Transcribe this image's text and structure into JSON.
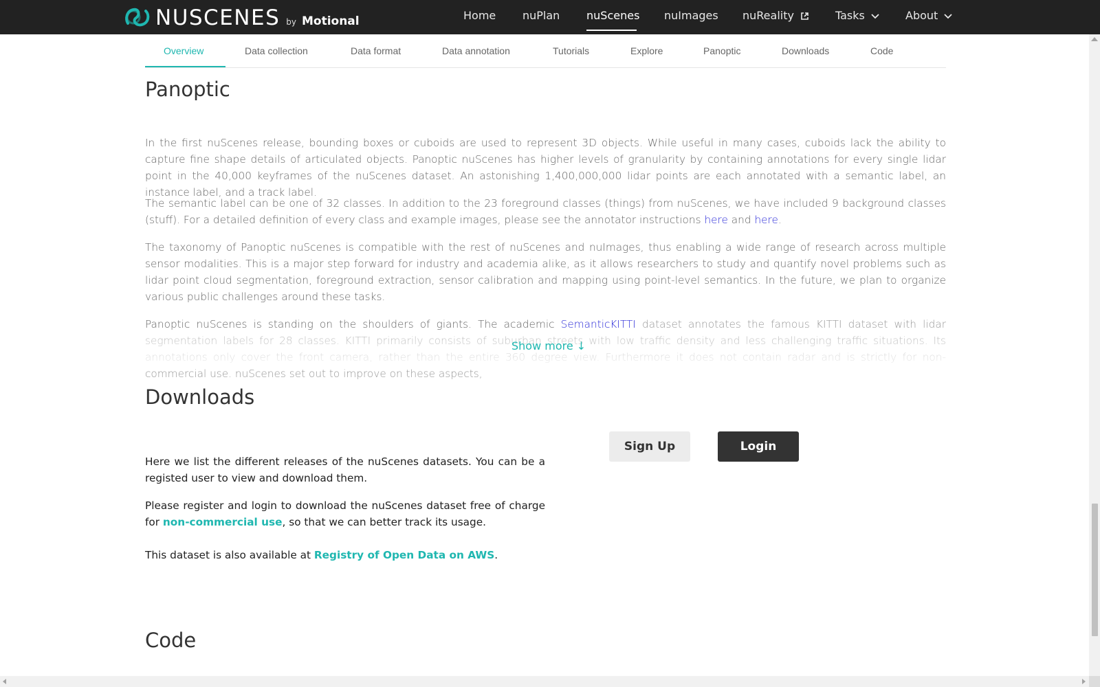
{
  "brand": {
    "name": "NUSCENES",
    "by": "by",
    "company": "Motional"
  },
  "nav": {
    "items": [
      {
        "label": "Home"
      },
      {
        "label": "nuPlan"
      },
      {
        "label": "nuScenes"
      },
      {
        "label": "nuImages"
      },
      {
        "label": "nuReality"
      },
      {
        "label": "Tasks"
      },
      {
        "label": "About"
      }
    ],
    "active": "nuScenes"
  },
  "subtabs": {
    "items": [
      "Overview",
      "Data collection",
      "Data format",
      "Data annotation",
      "Tutorials",
      "Explore",
      "Panoptic",
      "Downloads",
      "Code"
    ],
    "active": "Overview"
  },
  "panoptic": {
    "title": "Panoptic",
    "p1": "In the first nuScenes release, bounding boxes or cuboids are used to represent 3D objects. While useful in many cases, cuboids lack the ability to capture fine shape details of articulated objects. Panoptic nuScenes has higher levels of granularity by containing annotations for every single lidar point in the 40,000 keyframes of the nuScenes dataset. An astonishing 1,400,000,000 lidar points are each annotated with a semantic label, an instance label, and a track label.",
    "p2_before": "The semantic label can be one of 32 classes. In addition to the 23 foreground classes (things) from nuScenes, we have included 9 background classes (stuff). For a detailed definition of every class and example images, please see the annotator instructions ",
    "p2_link1": "here",
    "p2_mid": " and ",
    "p2_link2": "here",
    "p2_after": ".",
    "p3": "The taxonomy of Panoptic nuScenes is compatible with the rest of nuScenes and nuImages, thus enabling a wide range of research across multiple sensor modalities. This is a major step forward for industry and academia alike, as it allows researchers to study and quantify novel problems such as lidar point cloud segmentation, foreground extraction, sensor calibration and mapping using point-level semantics. In the future, we plan to organize various public challenges around these tasks.",
    "p4_before": "Panoptic nuScenes is standing on the shoulders of giants. The academic ",
    "p4_link": "SemanticKITTI",
    "p4_after": " dataset annotates the famous KITTI dataset with lidar segmentation labels for 28 classes. KITTI primarily consists of suburban streets with low traffic density and less challenging traffic situations. Its annotations only cover the front camera, rather than the entire 360 degree view. Furthermore it does not contain radar and is strictly for non-commercial use. nuScenes set out to improve on these aspects,",
    "show_more": "Show more ↓"
  },
  "downloads": {
    "title": "Downloads",
    "p1": "Here we list the different releases of the nuScenes datasets. You can be a registed user to view and download them.",
    "p2_before": "Please register and login to download the nuScenes dataset free of charge for ",
    "p2_link": "non-commercial use",
    "p2_after": ", so that we can better track its usage.",
    "p3_before": "This dataset is also available at ",
    "p3_link": "Registry of Open Data on AWS",
    "p3_after": ".",
    "signup": "Sign Up",
    "login": "Login"
  },
  "code": {
    "title": "Code"
  },
  "colors": {
    "accent": "#1fb7b0",
    "nav_bg": "#222222",
    "link": "#2a2ad8"
  }
}
